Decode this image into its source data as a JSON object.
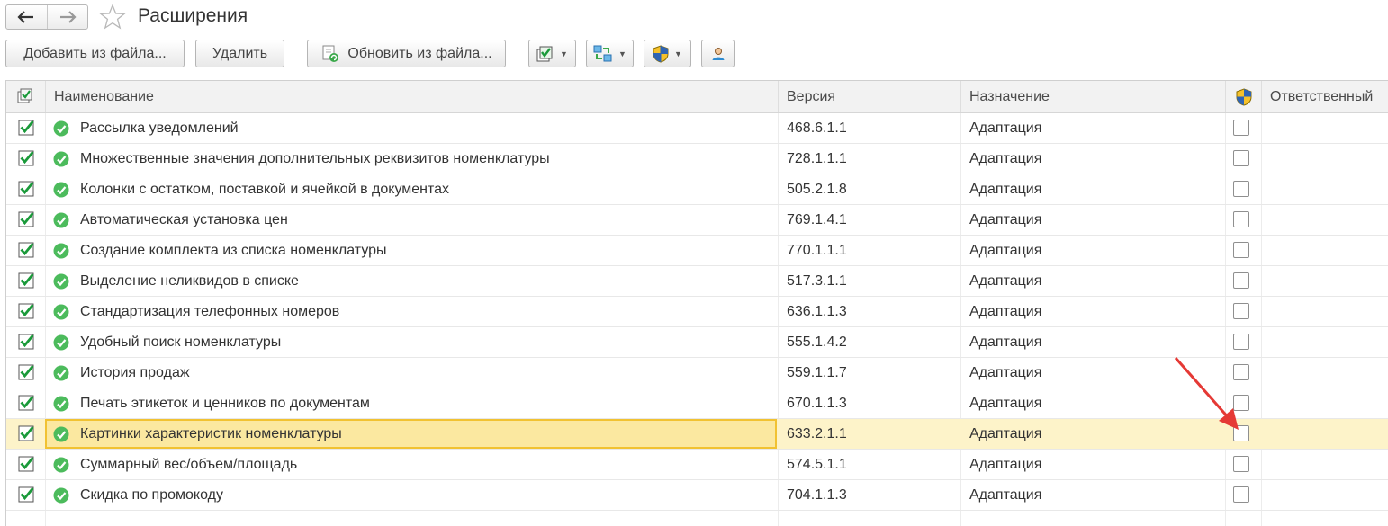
{
  "window": {
    "title": "Расширения"
  },
  "nav": {
    "back_icon": "arrow-left-icon",
    "forward_icon": "arrow-right-icon",
    "favorite_icon": "star-icon"
  },
  "toolbar": {
    "add_from_file": "Добавить из файла...",
    "delete": "Удалить",
    "update_from_file": "Обновить из файла...",
    "icons": [
      "checkbox-menu-icon",
      "sync-menu-icon",
      "shield-menu-icon",
      "user-icon"
    ]
  },
  "table": {
    "columns": {
      "active": "",
      "name": "Наименование",
      "version": "Версия",
      "purpose": "Назначение",
      "safe_mode": "",
      "responsible": "Ответственный"
    },
    "rows": [
      {
        "active": true,
        "name": "Рассылка уведомлений",
        "version": "468.6.1.1",
        "purpose": "Адаптация",
        "safe_mode": false,
        "responsible": ""
      },
      {
        "active": true,
        "name": "Множественные значения дополнительных реквизитов номенклатуры",
        "version": "728.1.1.1",
        "purpose": "Адаптация",
        "safe_mode": false,
        "responsible": ""
      },
      {
        "active": true,
        "name": "Колонки с остатком, поставкой и ячейкой в документах",
        "version": "505.2.1.8",
        "purpose": "Адаптация",
        "safe_mode": false,
        "responsible": ""
      },
      {
        "active": true,
        "name": "Автоматическая установка цен",
        "version": "769.1.4.1",
        "purpose": "Адаптация",
        "safe_mode": false,
        "responsible": ""
      },
      {
        "active": true,
        "name": "Создание комплекта из списка номенклатуры",
        "version": "770.1.1.1",
        "purpose": "Адаптация",
        "safe_mode": false,
        "responsible": ""
      },
      {
        "active": true,
        "name": "Выделение неликвидов в списке",
        "version": "517.3.1.1",
        "purpose": "Адаптация",
        "safe_mode": false,
        "responsible": ""
      },
      {
        "active": true,
        "name": "Стандартизация телефонных номеров",
        "version": "636.1.1.3",
        "purpose": "Адаптация",
        "safe_mode": false,
        "responsible": ""
      },
      {
        "active": true,
        "name": "Удобный поиск номенклатуры",
        "version": "555.1.4.2",
        "purpose": "Адаптация",
        "safe_mode": false,
        "responsible": ""
      },
      {
        "active": true,
        "name": "История продаж",
        "version": "559.1.1.7",
        "purpose": "Адаптация",
        "safe_mode": false,
        "responsible": ""
      },
      {
        "active": true,
        "name": "Печать этикеток и ценников по документам",
        "version": "670.1.1.3",
        "purpose": "Адаптация",
        "safe_mode": false,
        "responsible": ""
      },
      {
        "active": true,
        "name": "Картинки характеристик номенклатуры",
        "version": "633.2.1.1",
        "purpose": "Адаптация",
        "safe_mode": false,
        "responsible": "",
        "selected": true
      },
      {
        "active": true,
        "name": "Суммарный вес/объем/площадь",
        "version": "574.5.1.1",
        "purpose": "Адаптация",
        "safe_mode": false,
        "responsible": ""
      },
      {
        "active": true,
        "name": "Скидка по промокоду",
        "version": "704.1.1.3",
        "purpose": "Адаптация",
        "safe_mode": false,
        "responsible": ""
      }
    ]
  },
  "colors": {
    "accent_green": "#1a9a3a",
    "status_ok": "#4cbb5c",
    "selection_bg": "#fdf3c9",
    "selection_border": "#f1c232",
    "annotation_arrow": "#e53935"
  }
}
